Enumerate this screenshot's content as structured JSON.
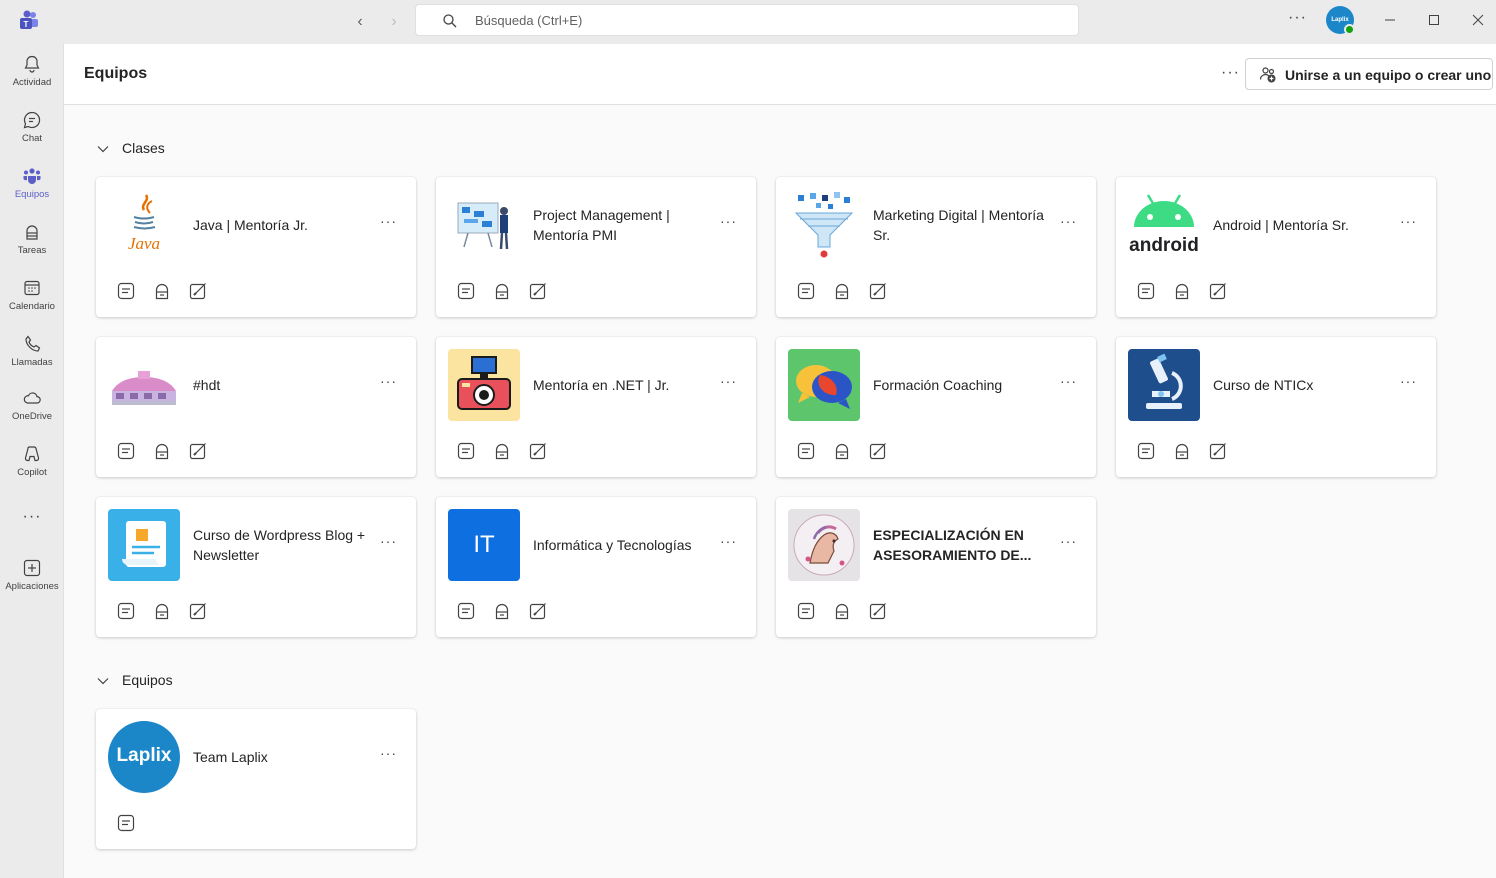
{
  "titlebar": {
    "search_placeholder": "Búsqueda (Ctrl+E)",
    "avatar_text": "Laplix"
  },
  "rail": {
    "items": [
      {
        "label": "Actividad",
        "icon": "bell-icon"
      },
      {
        "label": "Chat",
        "icon": "chat-icon"
      },
      {
        "label": "Equipos",
        "icon": "teams-icon",
        "active": true
      },
      {
        "label": "Tareas",
        "icon": "tasks-icon"
      },
      {
        "label": "Calendario",
        "icon": "calendar-icon"
      },
      {
        "label": "Llamadas",
        "icon": "phone-icon"
      },
      {
        "label": "OneDrive",
        "icon": "cloud-icon"
      },
      {
        "label": "Copilot",
        "icon": "copilot-icon"
      },
      {
        "label": "Aplicaciones",
        "icon": "add-apps-icon"
      }
    ],
    "more": "···"
  },
  "header": {
    "title": "Equipos",
    "more": "···",
    "join_label": "Unirse a un equipo o crear uno"
  },
  "sections": [
    {
      "label": "Clases",
      "teams": [
        {
          "name": "Java | Mentoría Jr.",
          "thumb": "java"
        },
        {
          "name": "Project Management | Mentoría PMI",
          "thumb": "pm"
        },
        {
          "name": "Marketing Digital | Mentoría Sr.",
          "thumb": "funnel"
        },
        {
          "name": "Android | Mentoría Sr.",
          "thumb": "android"
        },
        {
          "name": "#hdt",
          "thumb": "building"
        },
        {
          "name": "Mentoría en .NET | Jr.",
          "thumb": "camera"
        },
        {
          "name": "Formación Coaching",
          "thumb": "bubbles"
        },
        {
          "name": "Curso de NTICx",
          "thumb": "microscope"
        },
        {
          "name": "Curso de Wordpress Blog + Newsletter",
          "thumb": "scroll"
        },
        {
          "name": "Informática y Tecnologías",
          "thumb": "it",
          "thumb_text": "IT"
        },
        {
          "name": "ESPECIALIZACIÓN EN ASESORAMIENTO DE...",
          "thumb": "horse",
          "bold": true
        }
      ]
    },
    {
      "label": "Equipos",
      "teams": [
        {
          "name": "Team Laplix",
          "thumb": "laplix",
          "thumb_text": "Laplix"
        }
      ]
    }
  ],
  "colors": {
    "accent": "#5b5fc7",
    "it_tile": "#0d6fe0",
    "laplix": "#1b87c9",
    "android_green": "#3ddc84"
  },
  "thumb_labels": {
    "java": "Java",
    "android": "android"
  },
  "card_more": "···"
}
